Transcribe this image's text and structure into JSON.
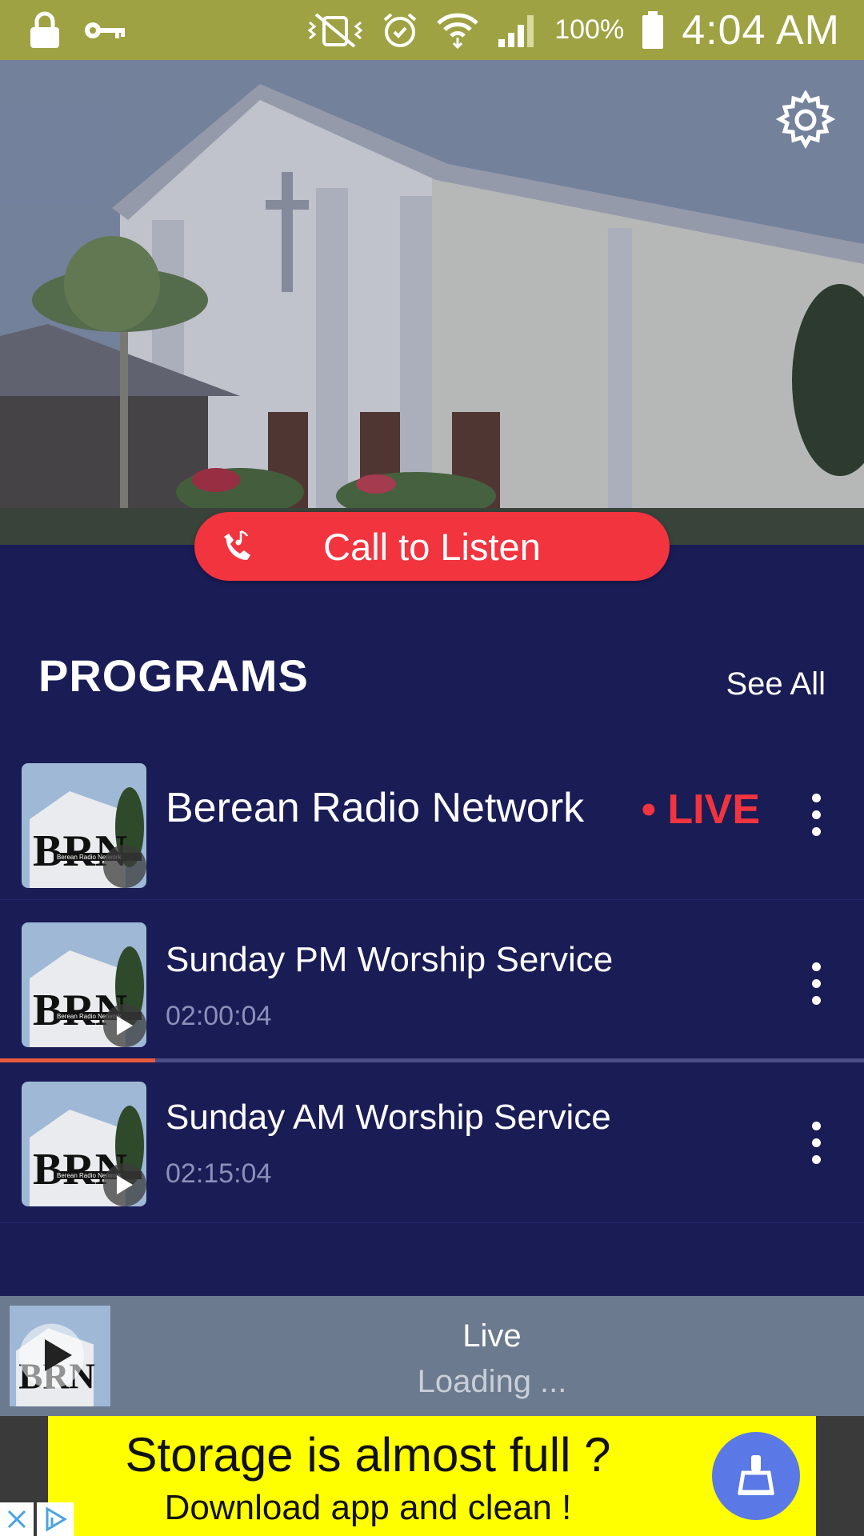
{
  "status_bar": {
    "battery_text": "100%",
    "time": "4:04 AM"
  },
  "hero": {
    "call_button_label": "Call to Listen"
  },
  "programs": {
    "title": "PROGRAMS",
    "see_all": "See All",
    "items": [
      {
        "title": "Berean Radio Network",
        "badge": "• LIVE"
      },
      {
        "title": "Sunday PM Worship Service",
        "duration": "02:00:04"
      },
      {
        "title": "Sunday AM Worship Service",
        "duration": "02:15:04"
      }
    ],
    "progress_fraction": 0.18
  },
  "player": {
    "title": "Live",
    "status": "Loading ..."
  },
  "ad": {
    "line1": "Storage is almost full ?",
    "line2": "Download app and clean !"
  },
  "colors": {
    "status_bar": "#9ea243",
    "background": "#1a1c56",
    "accent_red": "#f2343f",
    "player_bar": "#6b7a8e",
    "ad_yellow": "#ffff00"
  }
}
